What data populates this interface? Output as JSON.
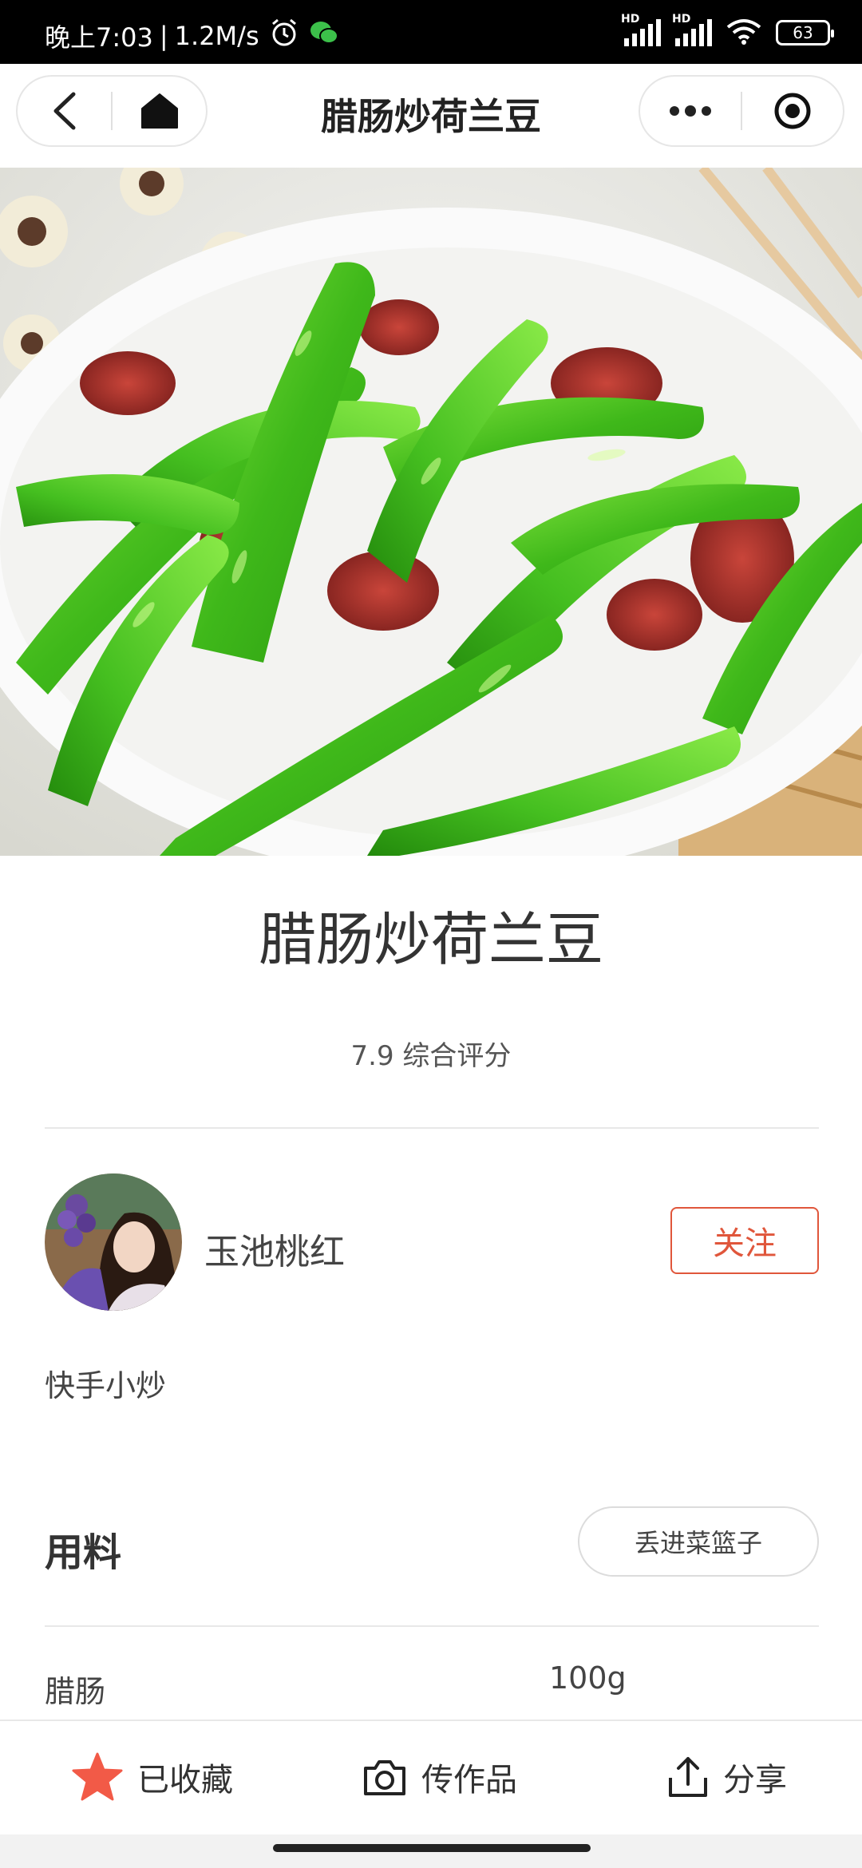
{
  "status_bar": {
    "time": "晚上7:03",
    "speed": "1.2M/s",
    "battery": "63",
    "sig1_label": "HD",
    "sig2_label": "HD"
  },
  "nav": {
    "title": "腊肠炒荷兰豆"
  },
  "recipe": {
    "title": "腊肠炒荷兰豆",
    "rating": "7.9 综合评分",
    "description": "快手小炒"
  },
  "author": {
    "name": "玉池桃红",
    "follow_label": "关注"
  },
  "ingredients": {
    "section_title": "用料",
    "basket_label": "丢进菜篮子",
    "items": [
      {
        "name": "腊肠",
        "amount": "100g"
      }
    ]
  },
  "bottom_bar": {
    "collect_label": "已收藏",
    "upload_label": "传作品",
    "share_label": "分享"
  },
  "colors": {
    "accent": "#e0563b",
    "star": "#f25a47"
  }
}
